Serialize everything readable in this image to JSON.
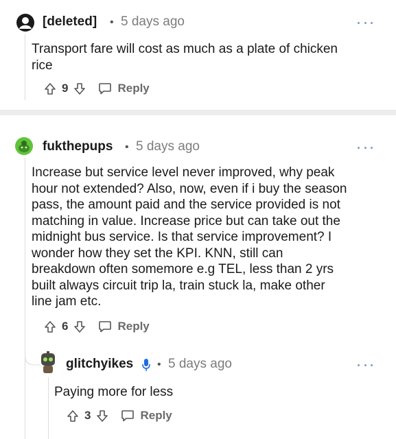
{
  "comments": [
    {
      "author": "[deleted]",
      "separator": "•",
      "time": "5 days ago",
      "body_lines": [
        "Transport fare will cost as much as a plate of chicken",
        "rice"
      ],
      "votes": "9",
      "reply_label": "Reply",
      "avatar_icon": "deleted-user-avatar"
    },
    {
      "author": "fukthepups",
      "separator": "•",
      "time": "5 days ago",
      "body_lines": [
        "Increase but service level never improved, why peak",
        "hour not extended? Also, now, even if i buy the season",
        "pass, the amount paid and the service provided is not",
        "matching in value. Increase price but can take out the",
        "midnight bus service. Is that service improvement? I",
        "wonder how they set the KPI. KNN, still can",
        "breakdown often somemore e.g TEL, less than 2 yrs",
        "built always circuit trip la, train stuck la, make other",
        "line jam etc."
      ],
      "votes": "6",
      "reply_label": "Reply",
      "avatar_icon": "green-snoo-avatar"
    },
    {
      "author": "glitchyikes",
      "separator": "•",
      "time": "5 days ago",
      "body_lines": [
        "Paying more for less"
      ],
      "votes": "3",
      "reply_label": "Reply",
      "avatar_icon": "robot-snoo-avatar",
      "badge_icon": "microphone-icon"
    }
  ],
  "colors": {
    "accent_link": "#7a9cc6",
    "avatar_green": "#5fc43a",
    "text_primary": "#1a1a1b",
    "text_meta": "#7c7c7c"
  }
}
